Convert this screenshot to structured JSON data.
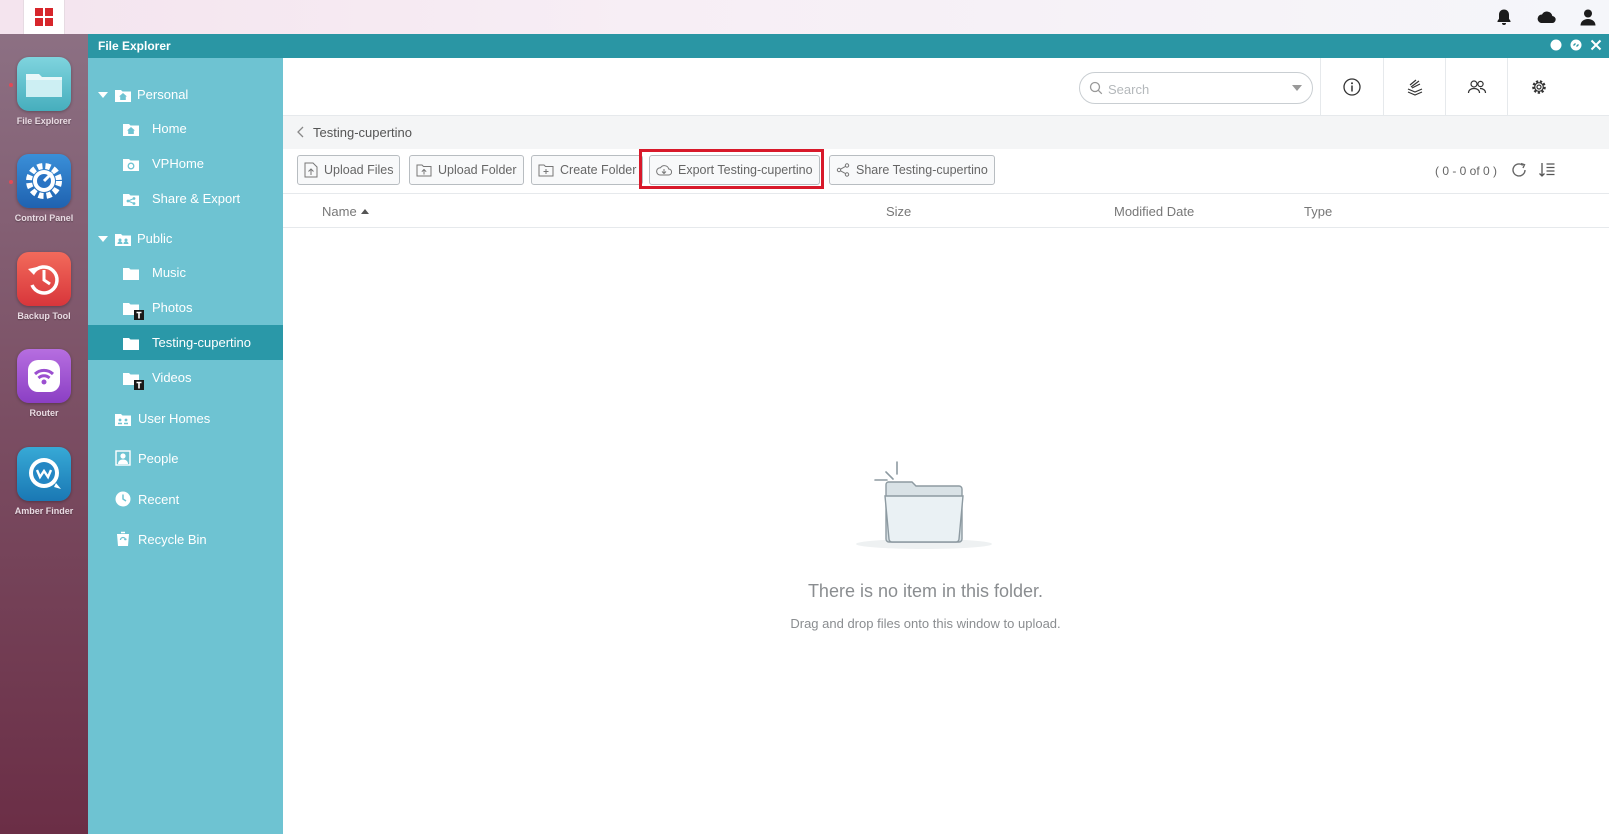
{
  "window": {
    "title": "File Explorer"
  },
  "dock": {
    "items": [
      {
        "label": "File Explorer",
        "icon": "folder-app-icon"
      },
      {
        "label": "Control Panel",
        "icon": "gear-app-icon"
      },
      {
        "label": "Backup Tool",
        "icon": "backup-clock-icon"
      },
      {
        "label": "Router",
        "icon": "wifi-router-icon"
      },
      {
        "label": "Amber Finder",
        "icon": "amber-finder-icon"
      }
    ]
  },
  "sidebar": {
    "personal": {
      "label": "Personal",
      "items": [
        {
          "label": "Home"
        },
        {
          "label": "VPHome"
        },
        {
          "label": "Share & Export"
        }
      ]
    },
    "public": {
      "label": "Public",
      "items": [
        {
          "label": "Music"
        },
        {
          "label": "Photos"
        },
        {
          "label": "Testing-cupertino"
        },
        {
          "label": "Videos"
        }
      ]
    },
    "others": [
      {
        "label": "User Homes"
      },
      {
        "label": "People"
      },
      {
        "label": "Recent"
      },
      {
        "label": "Recycle Bin"
      }
    ],
    "selected": "Testing-cupertino",
    "badge": "T"
  },
  "header": {
    "search_placeholder": "Search"
  },
  "breadcrumb": {
    "current": "Testing-cupertino"
  },
  "toolbar": {
    "upload_files": "Upload Files",
    "upload_folder": "Upload Folder",
    "create_folder": "Create Folder",
    "export": "Export Testing-cupertino",
    "share": "Share Testing-cupertino",
    "pager": "( 0 - 0 of 0 )"
  },
  "columns": {
    "name": "Name",
    "size": "Size",
    "modified": "Modified Date",
    "type": "Type"
  },
  "empty": {
    "title": "There is no item in this folder.",
    "subtitle": "Drag and drop files onto this window to upload."
  },
  "colors": {
    "title_bar": "#2a96a4",
    "sidebar": "#6ec3d2",
    "sidebar_active": "#2a98a8",
    "highlight": "#d8192a"
  }
}
